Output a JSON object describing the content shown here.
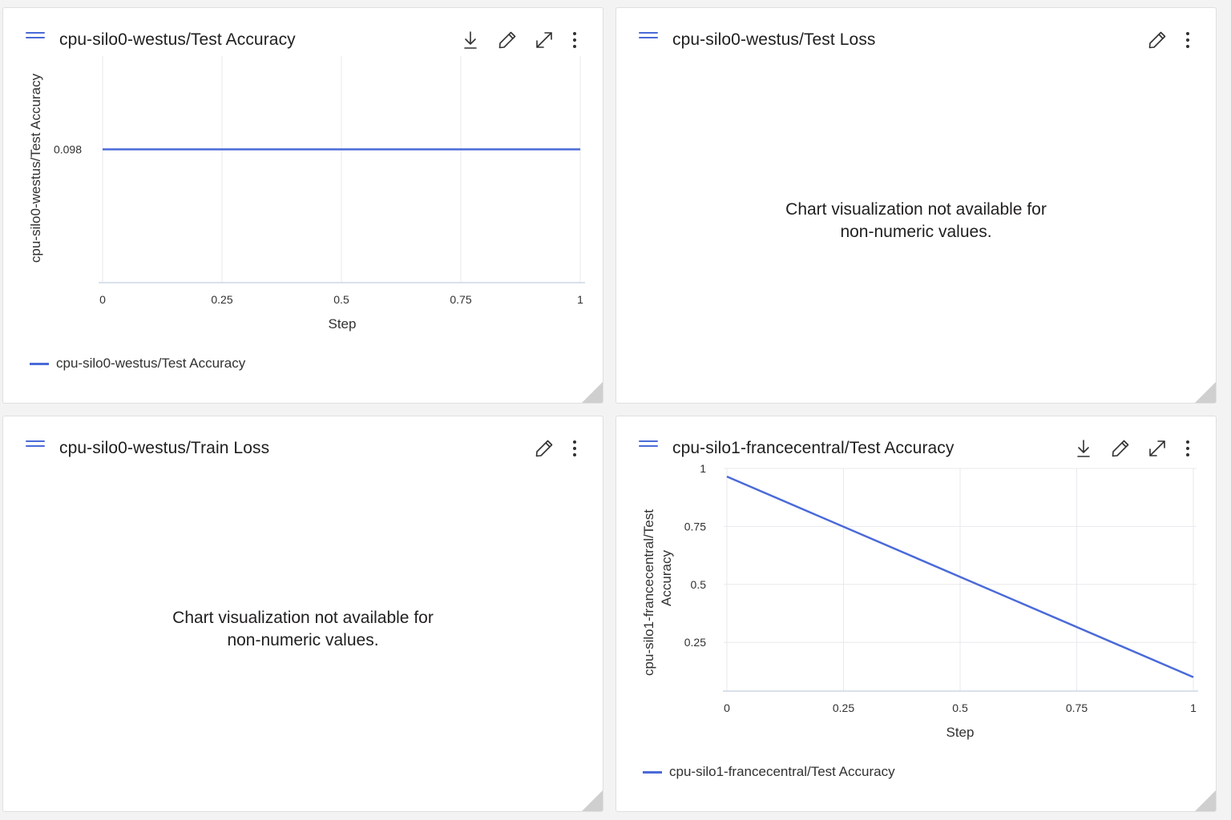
{
  "panels": [
    {
      "title": "cpu-silo0-westus/Test Accuracy",
      "actions": [
        "download-icon",
        "edit-icon",
        "expand-icon",
        "more-icon"
      ],
      "legend": "cpu-silo0-westus/Test Accuracy",
      "ylabel": "cpu-silo0-westus/Test Accuracy",
      "xlabel": "Step"
    },
    {
      "title": "cpu-silo0-westus/Test Loss",
      "actions": [
        "edit-icon",
        "more-icon"
      ],
      "message_line1": "Chart visualization not available for",
      "message_line2": "non-numeric values."
    },
    {
      "title": "cpu-silo0-westus/Train Loss",
      "actions": [
        "edit-icon",
        "more-icon"
      ],
      "message_line1": "Chart visualization not available for",
      "message_line2": "non-numeric values."
    },
    {
      "title": "cpu-silo1-francecentral/Test Accuracy",
      "actions": [
        "download-icon",
        "edit-icon",
        "expand-icon",
        "more-icon"
      ],
      "legend": "cpu-silo1-francecentral/Test Accuracy",
      "ylabel_line1": "cpu-silo1-francecentral/Test",
      "ylabel_line2": "Accuracy",
      "xlabel": "Step"
    }
  ],
  "colors": {
    "series": "#4a6ad8",
    "grid": "#e8e8ee",
    "axis": "#cdd5e6"
  },
  "chart_data": [
    {
      "type": "line",
      "title": "cpu-silo0-westus/Test Accuracy",
      "xlabel": "Step",
      "ylabel": "cpu-silo0-westus/Test Accuracy",
      "x_ticks": [
        "0",
        "0.25",
        "0.5",
        "0.75",
        "1"
      ],
      "y_ticks": [
        "0.098"
      ],
      "xlim": [
        0,
        1
      ],
      "series": [
        {
          "name": "cpu-silo0-westus/Test Accuracy",
          "x": [
            0,
            1
          ],
          "y": [
            0.098,
            0.098
          ]
        }
      ],
      "grid": true,
      "legend_position": "bottom-left"
    },
    {
      "type": "line",
      "title": "cpu-silo1-francecentral/Test Accuracy",
      "xlabel": "Step",
      "ylabel": "cpu-silo1-francecentral/Test Accuracy",
      "x_ticks": [
        "0",
        "0.25",
        "0.5",
        "0.75",
        "1"
      ],
      "y_ticks": [
        "1",
        "0.75",
        "0.5",
        "0.25"
      ],
      "xlim": [
        0,
        1
      ],
      "ylim": [
        0.04,
        1
      ],
      "series": [
        {
          "name": "cpu-silo1-francecentral/Test Accuracy",
          "x": [
            0,
            1
          ],
          "y": [
            0.965,
            0.1
          ]
        }
      ],
      "grid": true,
      "legend_position": "bottom-left"
    }
  ]
}
